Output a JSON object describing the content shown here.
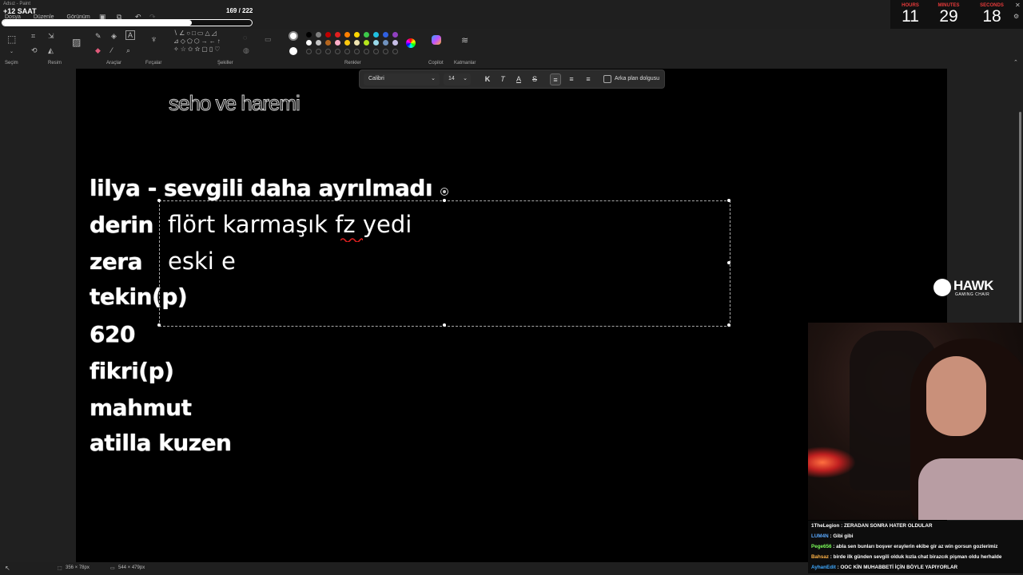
{
  "overlay": {
    "app_name": "Adsız - Paint",
    "saat": "+12 SAAT",
    "menu": [
      "Dosya",
      "Düzenle",
      "Görünüm"
    ],
    "sub_count": "169 / 222",
    "sub_progress_fraction": 0.76
  },
  "timer": {
    "hours_label": "HOURS",
    "hours": "11",
    "minutes_label": "MINUTES",
    "minutes": "29",
    "seconds_label": "SECONDS",
    "seconds": "18"
  },
  "ribbon": {
    "groups": [
      "Seçim",
      "Resim",
      "Araçlar",
      "Fırçalar",
      "Şekiller",
      "Renkler",
      "Copilot",
      "Katmanlar"
    ],
    "palette_row1": [
      "#000000",
      "#7f7f7f",
      "#c00000",
      "#e02020",
      "#ff8000",
      "#ffd700",
      "#3cc84a",
      "#20c0e0",
      "#3060e0",
      "#9040c0"
    ],
    "palette_row2": [
      "#ffffff",
      "#c3c3c3",
      "#b5651d",
      "#ffaec9",
      "#ffc90e",
      "#efe4b0",
      "#b5e61d",
      "#99d9ea",
      "#7092be",
      "#c8bfe7"
    ]
  },
  "format_bar": {
    "font": "Calibri",
    "size": "14",
    "bold": "K",
    "italic": "T",
    "color": "A",
    "strike": "S",
    "background_fill_label": "Arka plan dolgusu"
  },
  "canvas": {
    "title": "seho ve haremi",
    "lines": [
      "lilya - sevgili daha ayrılmadı",
      "derin",
      "zera",
      "tekin(p)",
      "620",
      "fikri(p)",
      "mahmut",
      "atilla kuzen"
    ],
    "textbox_lines": [
      "flört karmaşık fz yedi",
      "eski e"
    ]
  },
  "sponsor": {
    "name": "HAWK",
    "tagline": "GAMING CHAIR"
  },
  "chat": [
    {
      "user": "1TheLegion",
      "color": "#ffffff",
      "text": "ZERADAN SONRA HATER OLDULAR"
    },
    {
      "user": "LUM4N",
      "color": "#5aa9ff",
      "text": "Gibi gibi"
    },
    {
      "user": "Pegе656",
      "color": "#7cff5a",
      "text": "abla sen bunları boşver eraylerin ekibe gir az win gorsun gozlerimiz"
    },
    {
      "user": "Bahsaz",
      "color": "#ffb347",
      "text": "birde ilk günden sevgili olduk kızla chat birazcık pişman oldu herhalde"
    },
    {
      "user": "AyhanEdit",
      "color": "#3fa9ff",
      "text": "OOC KİN MUHABBETİ İÇİN BÖYLE YAPIYORLAR"
    }
  ],
  "status": {
    "selection_size": "356 × 78px",
    "canvas_size": "544 × 479px"
  }
}
